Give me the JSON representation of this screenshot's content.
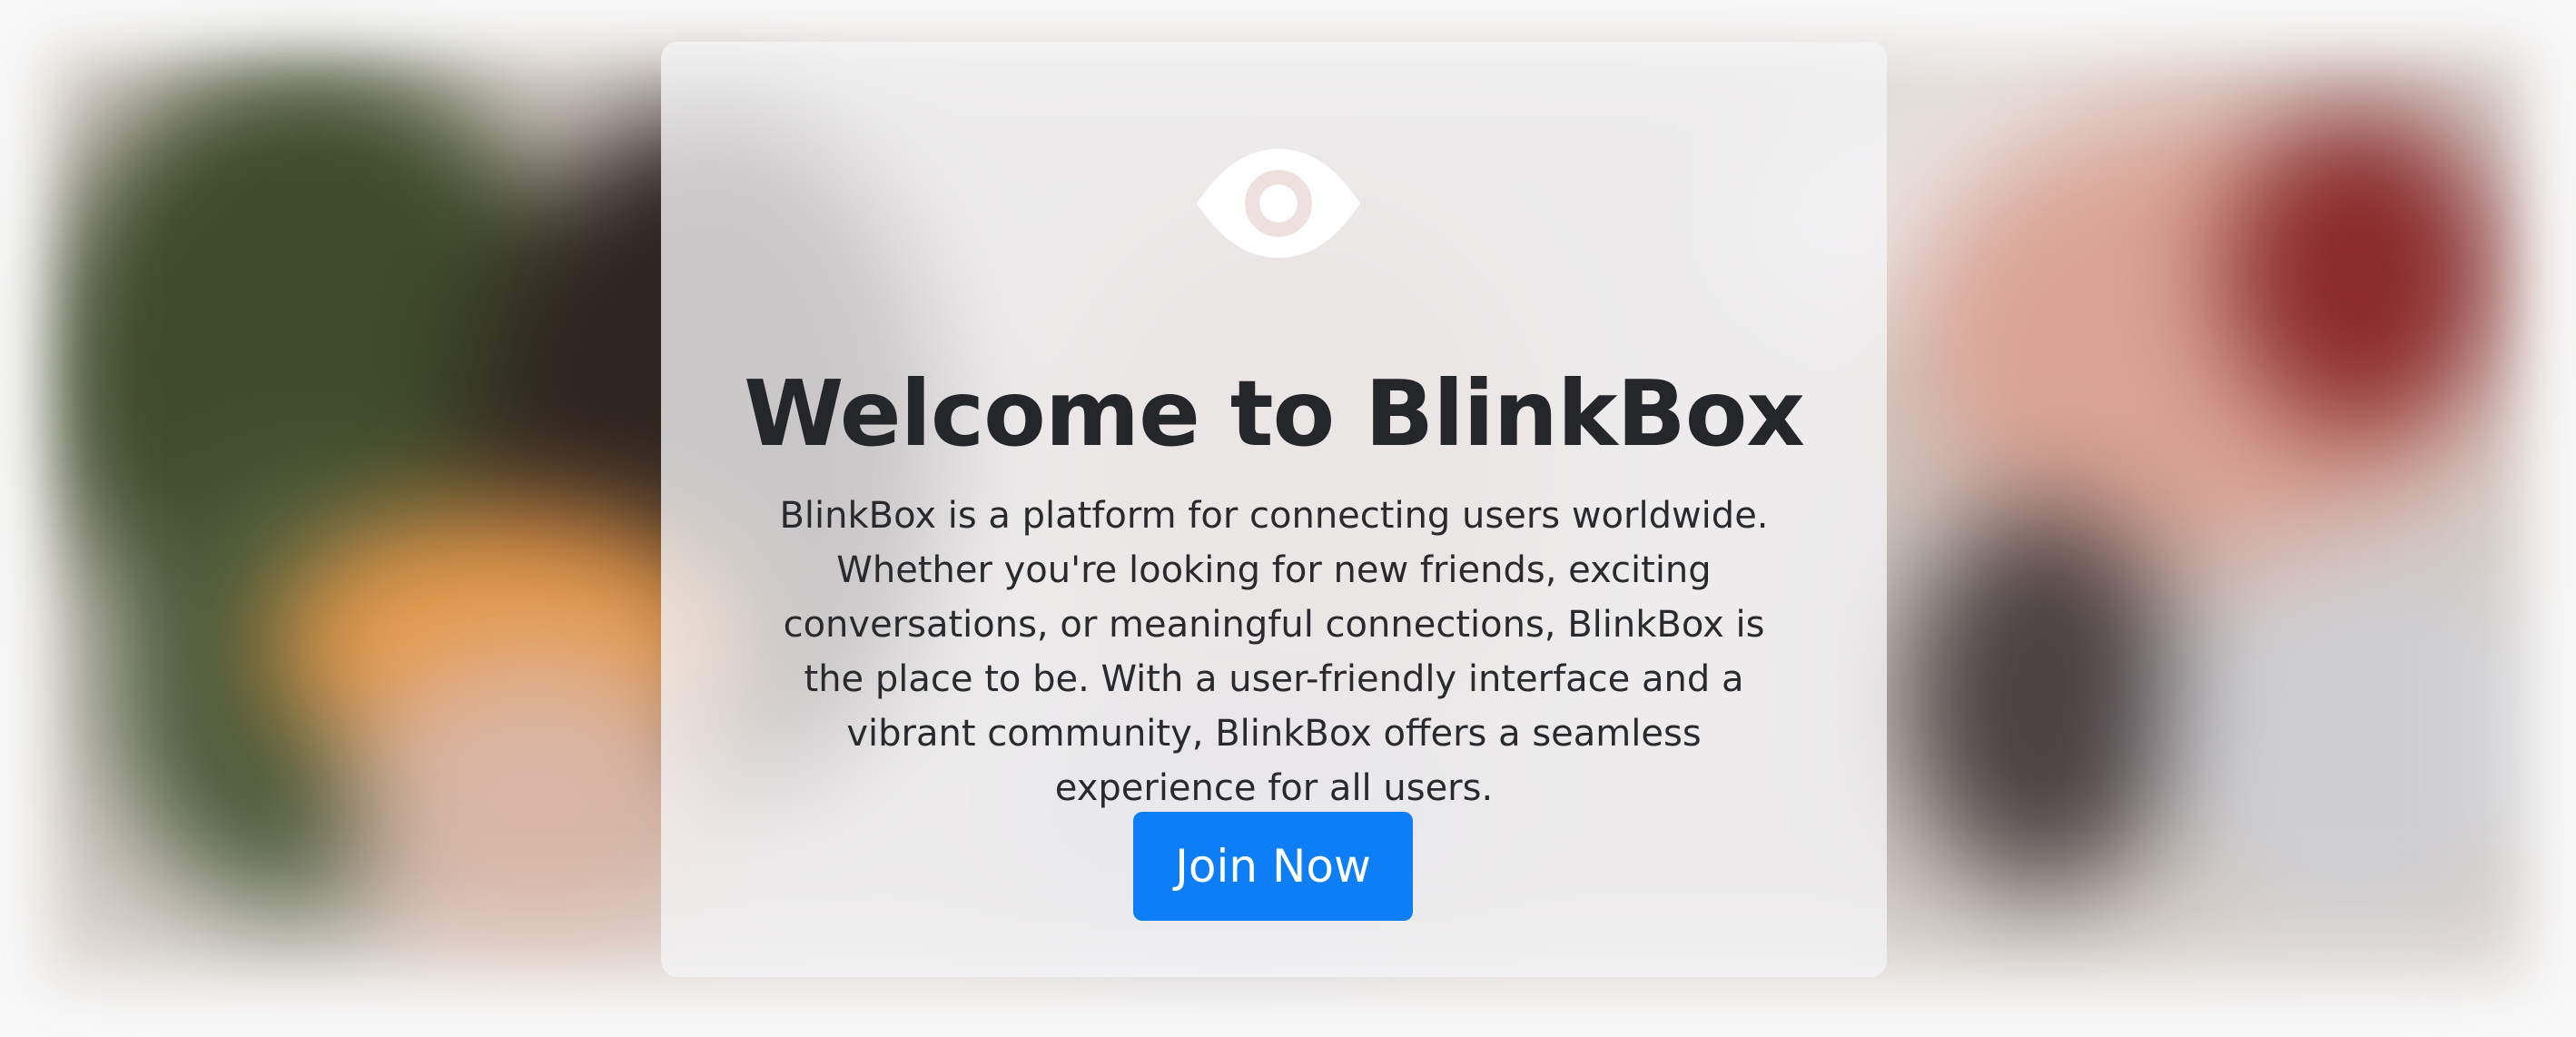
{
  "hero": {
    "logo_icon": "eye-icon",
    "title": "Welcome to BlinkBox",
    "description": "BlinkBox is a platform for connecting users worldwide. Whether you're looking for new friends, exciting conversations, or meaningful connections, BlinkBox is the place to be. With a user-friendly interface and a vibrant community, BlinkBox offers a seamless experience for all users.",
    "cta_label": "Join Now"
  },
  "colors": {
    "accent": "#0d7ef5",
    "title_text": "#25262a",
    "card_background": "#f5f5f7"
  }
}
